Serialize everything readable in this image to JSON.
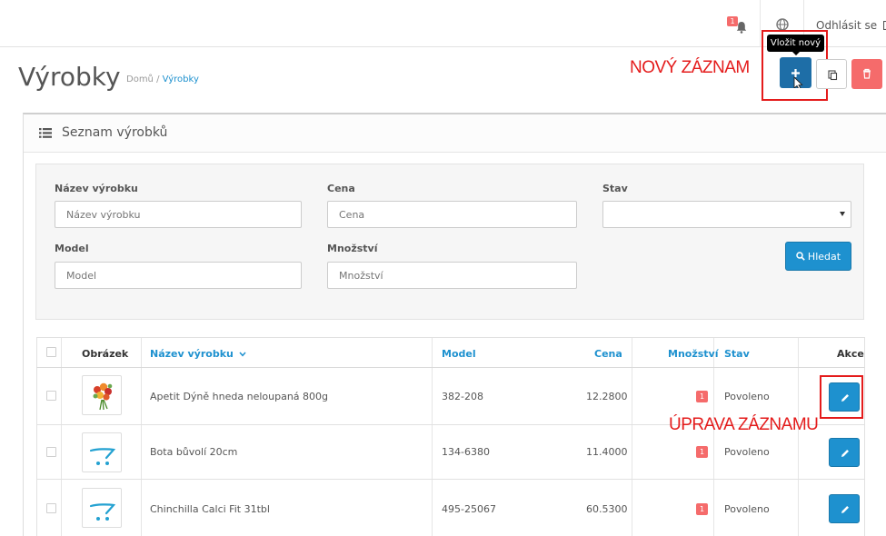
{
  "header": {
    "notification_count": "1",
    "logout_label": "Odhlásit se"
  },
  "tooltip": "Vložit nový",
  "page": {
    "title": "Výrobky",
    "breadcrumb": [
      "Domů",
      "Výrobky"
    ],
    "breadcrumb_sep": "/"
  },
  "annotations": {
    "new_record": "NOVÝ ZÁZNAM",
    "edit_record": "ÚPRAVA ZÁZNAMU"
  },
  "toolbar": {
    "add_icon": "plus-icon",
    "copy_icon": "copy-icon",
    "delete_icon": "trash-icon"
  },
  "panel": {
    "title": "Seznam výrobků"
  },
  "filter": {
    "name_label": "Název výrobku",
    "name_placeholder": "Název výrobku",
    "price_label": "Cena",
    "price_placeholder": "Cena",
    "status_label": "Stav",
    "status_value": "",
    "model_label": "Model",
    "model_placeholder": "Model",
    "quantity_label": "Množství",
    "quantity_placeholder": "Množství",
    "search_label": "Hledat"
  },
  "table": {
    "columns": {
      "image": "Obrázek",
      "name": "Název výrobku",
      "model": "Model",
      "price": "Cena",
      "quantity": "Množství",
      "status": "Stav",
      "action": "Akce"
    },
    "rows": [
      {
        "image": "flower-bouquet",
        "name": "Apetit Dýně hneda neloupaná 800g",
        "model": "382-208",
        "price": "12.2800",
        "quantity": "1",
        "status": "Povoleno"
      },
      {
        "image": "cart-placeholder",
        "name": "Bota bůvolí 20cm",
        "model": "134-6380",
        "price": "11.4000",
        "quantity": "1",
        "status": "Povoleno"
      },
      {
        "image": "cart-placeholder",
        "name": "Chinchilla Calci Fit 31tbl",
        "model": "495-25067",
        "price": "60.5300",
        "quantity": "1",
        "status": "Povoleno"
      }
    ]
  },
  "colors": {
    "primary": "#1e91cf",
    "primary_dark": "#1e6ea7",
    "danger": "#f56b6b",
    "annotation": "#e41b1b"
  }
}
